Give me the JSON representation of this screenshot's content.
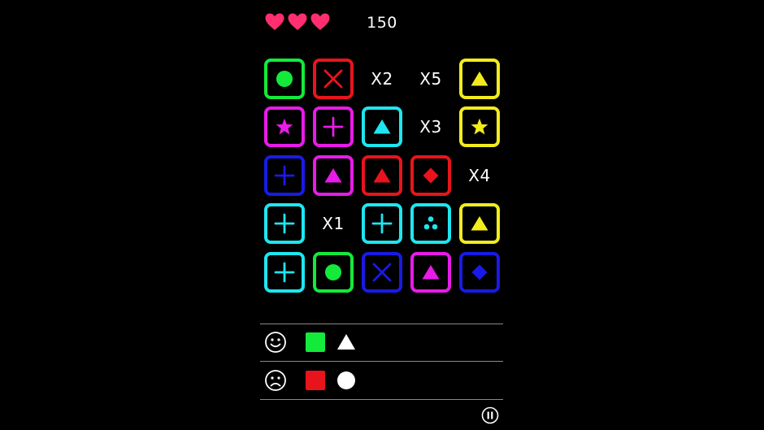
{
  "lives": 3,
  "score": "150",
  "colors": {
    "green": "#13ea3a",
    "red": "#e8141c",
    "yellow": "#f2ec1c",
    "magenta": "#e81be8",
    "cyan": "#1ee6f0",
    "blue": "#1a1ae6",
    "heart": "#ff2e6e"
  },
  "grid": [
    [
      {
        "color": "green",
        "shape": "circle"
      },
      {
        "color": "red",
        "shape": "x"
      },
      {
        "label": "X2"
      },
      {
        "label": "X5"
      },
      {
        "color": "yellow",
        "shape": "triangle"
      }
    ],
    [
      {
        "color": "magenta",
        "shape": "star"
      },
      {
        "color": "magenta",
        "shape": "plus"
      },
      {
        "color": "cyan",
        "shape": "triangle"
      },
      {
        "label": "X3"
      },
      {
        "color": "yellow",
        "shape": "star"
      }
    ],
    [
      {
        "color": "blue",
        "shape": "plus"
      },
      {
        "color": "magenta",
        "shape": "triangle"
      },
      {
        "color": "red",
        "shape": "triangle"
      },
      {
        "color": "red",
        "shape": "diamond"
      },
      {
        "label": "X4"
      }
    ],
    [
      {
        "color": "cyan",
        "shape": "plus"
      },
      {
        "label": "X1"
      },
      {
        "color": "cyan",
        "shape": "plus"
      },
      {
        "color": "cyan",
        "shape": "dots"
      },
      {
        "color": "yellow",
        "shape": "triangle"
      }
    ],
    [
      {
        "color": "cyan",
        "shape": "plus"
      },
      {
        "color": "green",
        "shape": "circle"
      },
      {
        "color": "blue",
        "shape": "x"
      },
      {
        "color": "magenta",
        "shape": "triangle"
      },
      {
        "color": "blue",
        "shape": "diamond"
      }
    ]
  ],
  "rules": {
    "good": {
      "icon": "smiley-icon",
      "square_color": "#13ea3a",
      "shape": "triangle"
    },
    "bad": {
      "icon": "sad-face-icon",
      "square_color": "#e8141c",
      "shape": "circle"
    }
  }
}
